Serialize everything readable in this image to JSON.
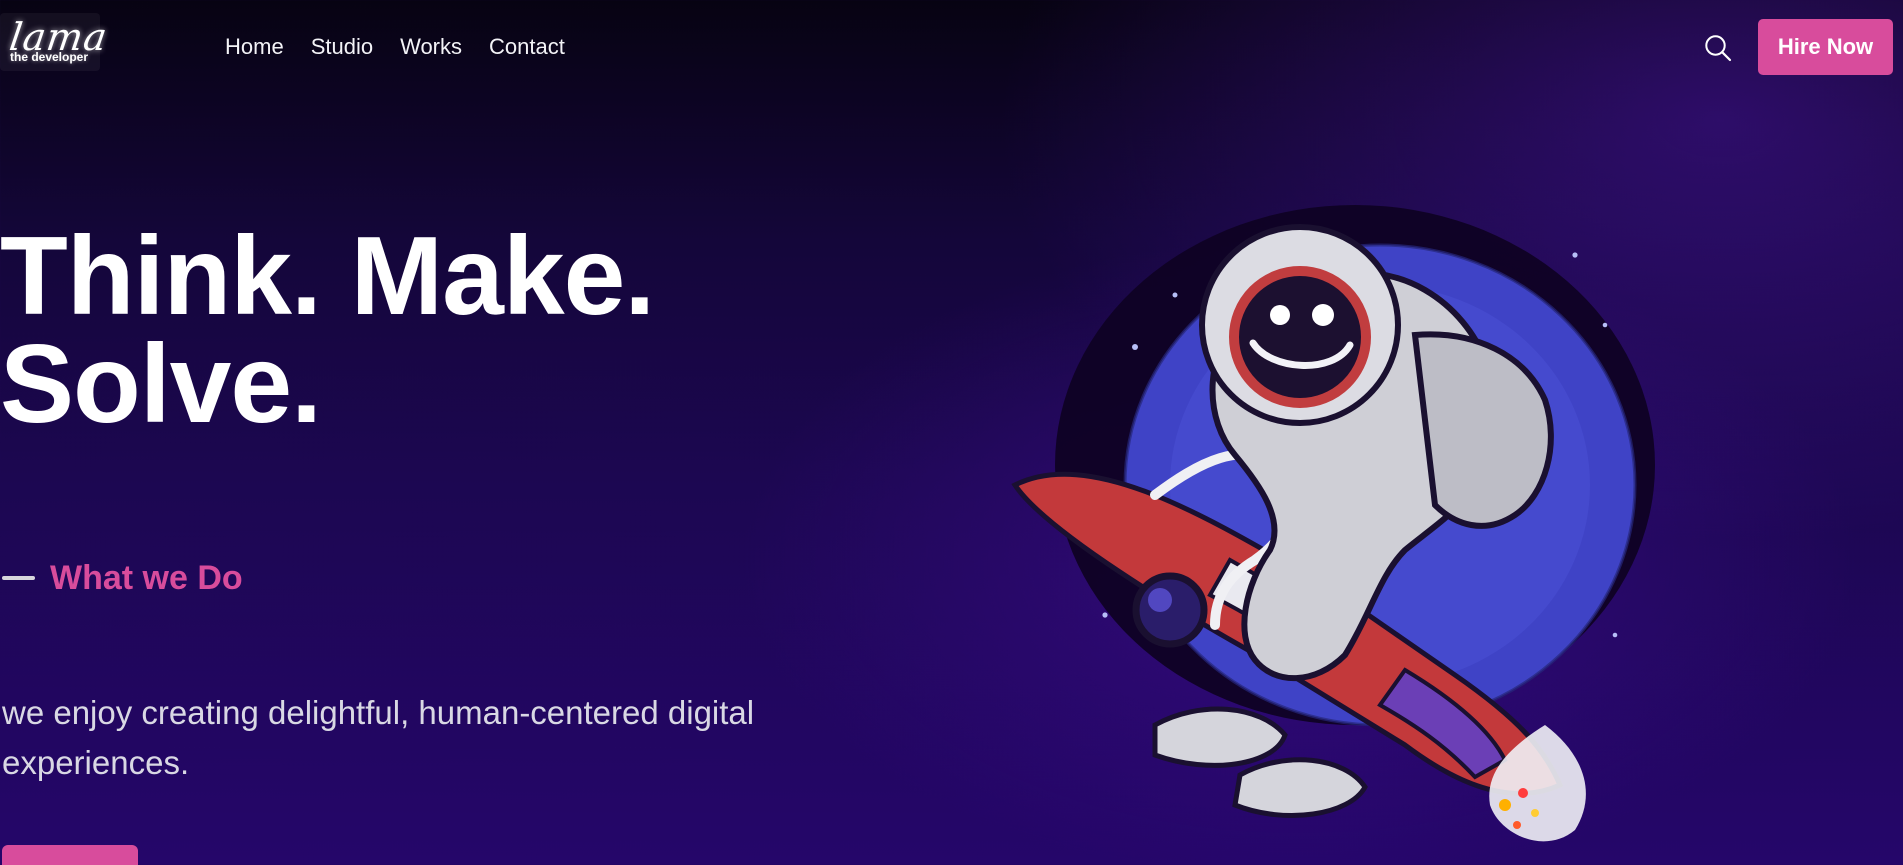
{
  "header": {
    "logo": {
      "main_text": "lama",
      "sub_text": "the developer"
    },
    "nav": {
      "items": [
        "Home",
        "Studio",
        "Works",
        "Contact"
      ]
    },
    "search_icon": "search-icon",
    "hire_button": "Hire Now"
  },
  "hero": {
    "title_line1": "Think. Make.",
    "title_line2": "Solve.",
    "section_label": "What we Do",
    "description_line1": "we enjoy creating delightful, human-centered digital",
    "description_line2": "experiences."
  },
  "colors": {
    "accent_pink": "#d84c9c",
    "bg_dark": "#070312",
    "bg_purple": "#25066a",
    "planet_blue": "#4a4fcf",
    "rocket_red": "#c3393b"
  }
}
